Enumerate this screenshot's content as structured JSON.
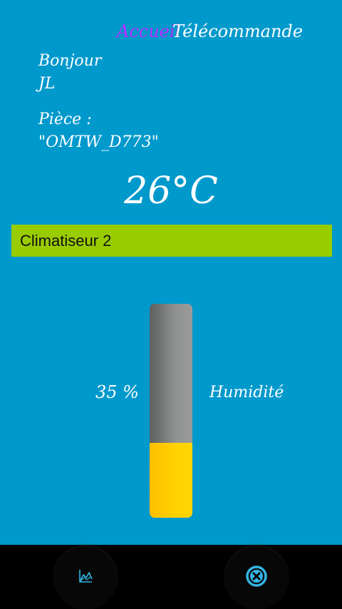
{
  "nav": {
    "accueil_label": "Accueil",
    "telecommande_label": "Télécommande"
  },
  "greeting": {
    "line1": "Bonjour",
    "line2": "JL"
  },
  "room": {
    "label": "Pièce :",
    "name": "\"OMTW_D773\""
  },
  "temperature": "26°C",
  "device": {
    "name": "Climatiseur 2"
  },
  "humidity": {
    "value_label": "35 %",
    "label": "Humidité",
    "percent": 35
  },
  "icons": {
    "left": "chart-icon",
    "right": "close-circle-icon"
  },
  "colors": {
    "background": "#0099cc",
    "accent": "#b42bff",
    "device_bar": "#99cc00",
    "gauge_fill": "#ffd200",
    "icon_cyan": "#33b5e5"
  }
}
